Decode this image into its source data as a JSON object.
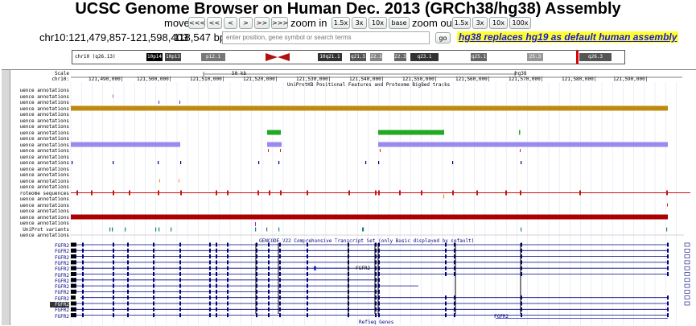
{
  "title": "UCSC Genome Browser on Human Dec. 2013 (GRCh38/hg38) Assembly",
  "nav": {
    "move_label": "move",
    "move_buttons": [
      "<<<",
      "<<",
      "<",
      ">",
      ">>",
      ">>>"
    ],
    "zoom_in_label": "zoom in",
    "zoom_in_buttons": [
      "1.5x",
      "3x",
      "10x",
      "base"
    ],
    "zoom_out_label": "zoom out",
    "zoom_out_buttons": [
      "1.5x",
      "3x",
      "10x",
      "100x"
    ]
  },
  "position": {
    "value": "chr10:121,479,857-121,598,403",
    "size": "118,547 bp.",
    "search_placeholder": "enter position, gene symbol or search terms",
    "go_label": "go",
    "notice": "hg38 replaces hg19 as default human assembly"
  },
  "ideogram": {
    "chrom_label": "chr10 (q26.13)",
    "bands": [
      {
        "label": "10p14",
        "color": "#000000"
      },
      {
        "label": "10p13",
        "color": "#444444"
      },
      {
        "label": "p12.1",
        "color": "#777777"
      },
      {
        "label": "10q21.1",
        "color": "#333333"
      },
      {
        "label": "q21.3",
        "color": "#555555"
      },
      {
        "label": "22.1",
        "color": "#888888"
      },
      {
        "label": "22.3",
        "color": "#666666"
      },
      {
        "label": "q23.1",
        "color": "#333333"
      },
      {
        "label": "q25.1",
        "color": "#666666"
      },
      {
        "label": "25.3",
        "color": "#999999"
      },
      {
        "label": "q26.3",
        "color": "#555555"
      }
    ],
    "highlight_color": "#e00000"
  },
  "ruler": {
    "scale_label": "Scale",
    "chrom_label": "chr10:",
    "scale_bar": "50 kb",
    "assembly": "hg38",
    "ticks": [
      "121,490,000|",
      "121,500,000|",
      "121,510,000|",
      "121,520,000|",
      "121,530,000|",
      "121,540,000|",
      "121,550,000|",
      "121,560,000|",
      "121,570,000|",
      "121,580,000|",
      "121,590,000|"
    ]
  },
  "uniprot_track_title": "UniProtKB Positional Features and Proteome BigBed tracks",
  "uniprot_rows": [
    "uence annotations",
    "uence annotations",
    "uence annotations",
    "uence annotations",
    "uence annotations",
    "uence annotations",
    "uence annotations",
    "uence annotations",
    "uence annotations",
    "uence annotations",
    "uence annotations",
    "uence annotations",
    "uence annotations",
    "uence annotations",
    "uence annotations",
    "uence annotations",
    "uence annotations",
    "roteome sequences",
    "uence annotations",
    "uence annotations",
    "uence annotations",
    "uence annotations",
    "uence annotations",
    "UniProt variants",
    "uence annotations"
  ],
  "gencode_track_title": "GENCODE V22 Comprehensive Transcript Set (only Basic displayed by default)",
  "gencode_rows": [
    "FGFR2",
    "FGFR2",
    "FGFR2",
    "FGFR2",
    "FGFR2",
    "FGFR2",
    "FGFR2",
    "FGFR2",
    "FGFR2",
    "FGFR2",
    "FGFR2",
    "FGFR2",
    "FGFR2"
  ],
  "inline_gene_labels": [
    "FGFR2",
    "FGFR2"
  ],
  "bottom_track_title": "RefSeq Genes",
  "colors": {
    "gold": "#c08a10",
    "green": "#22a822",
    "lavender": "#9a8af0",
    "red": "#cc1111",
    "dark_red": "#aa0000",
    "navy": "#00007c",
    "notice_bg": "#ffff33",
    "notice_text": "#1a1acc"
  }
}
